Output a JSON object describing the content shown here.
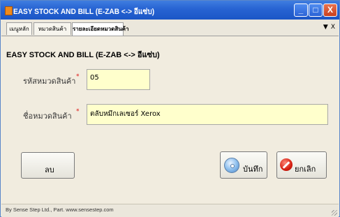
{
  "window": {
    "title": "EASY STOCK AND BILL (E-ZAB <-> อีแซ่บ)",
    "controls": {
      "min": "_",
      "max": "□",
      "close": "X"
    }
  },
  "tabs": [
    {
      "label": "เมนูหลัก"
    },
    {
      "label": "หมวดสินค้า"
    },
    {
      "label": "รายละเอียดหมวดสินค้า"
    }
  ],
  "tab_nav": {
    "down": "▼",
    "close": "X"
  },
  "form": {
    "heading": "EASY STOCK AND BILL (E-ZAB <-> อีแซ่บ)",
    "fields": [
      {
        "label": "รหัสหมวดสินค้า",
        "required": "*",
        "value": "05"
      },
      {
        "label": "ชื่อหมวดสินค้า",
        "required": "*",
        "value": "ตลับหมึกเลเซอร์ Xerox"
      }
    ]
  },
  "buttons": {
    "delete": "ลบ",
    "save": "บันทึก",
    "cancel": "ยกเลิก"
  },
  "status": {
    "text": "By Sense Step Ltd., Part. www.sensestep.com"
  },
  "colors": {
    "title_bar": "#2763d2",
    "input_bg": "#ffffcc",
    "form_bg": "#f1ecdf",
    "required": "#dd1111"
  }
}
